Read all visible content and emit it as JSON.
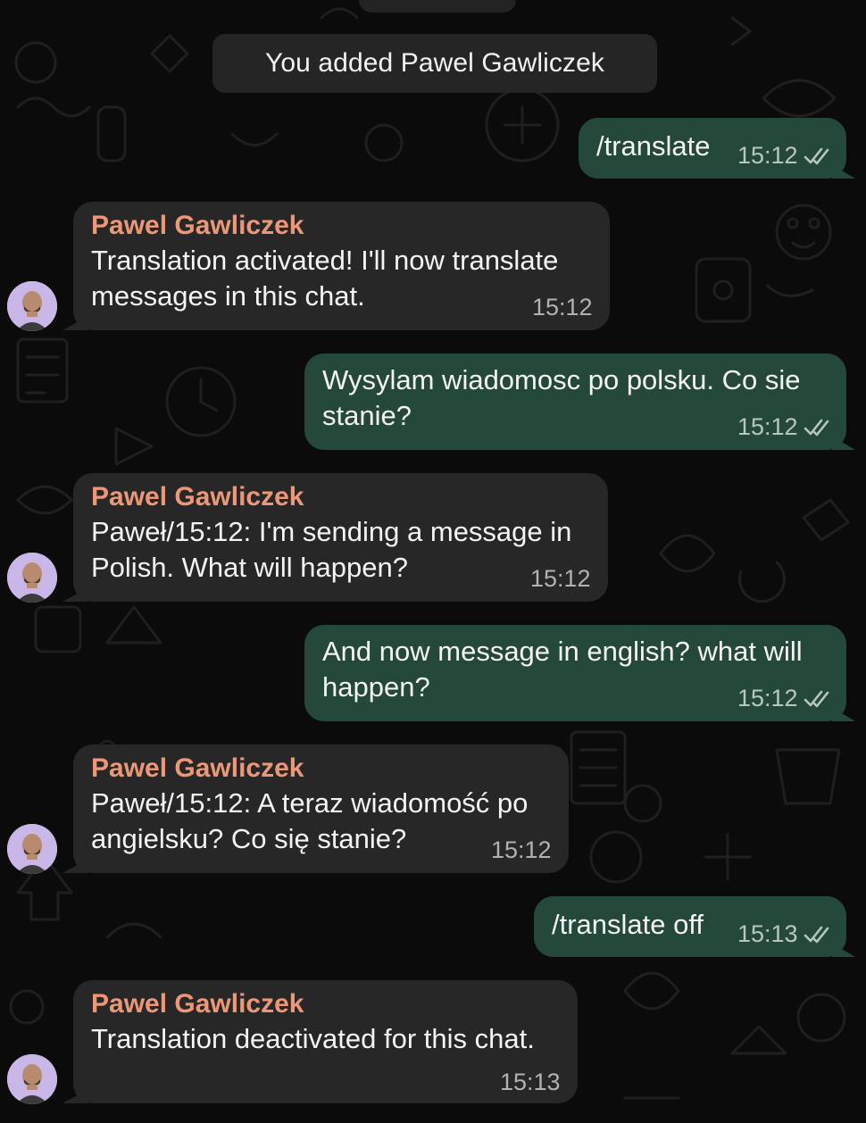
{
  "system_message": "You added Pawel Gawliczek",
  "messages": [
    {
      "direction": "out",
      "lines": [
        "/translate"
      ],
      "time": "15:12",
      "status_icon": "double-check-read-icon"
    },
    {
      "direction": "in",
      "sender": "Pawel Gawliczek",
      "lines": [
        "Translation activated! I'll now translate",
        "messages in this chat."
      ],
      "time": "15:12"
    },
    {
      "direction": "out",
      "lines": [
        "Wysylam wiadomosc po polsku. Co sie",
        "stanie?"
      ],
      "time": "15:12",
      "status_icon": "double-check-read-icon"
    },
    {
      "direction": "in",
      "sender": "Pawel Gawliczek",
      "lines": [
        "Paweł/15:12: I'm sending a message in",
        "Polish. What will happen?"
      ],
      "time": "15:12"
    },
    {
      "direction": "out",
      "lines": [
        "And now message in english? what will",
        "happen?"
      ],
      "time": "15:12",
      "status_icon": "double-check-read-icon"
    },
    {
      "direction": "in",
      "sender": "Pawel Gawliczek",
      "lines": [
        "Paweł/15:12: A teraz wiadomość po",
        "angielsku? Co się stanie?"
      ],
      "time": "15:12"
    },
    {
      "direction": "out",
      "lines": [
        "/translate off"
      ],
      "time": "15:13",
      "status_icon": "double-check-read-icon"
    },
    {
      "direction": "in",
      "sender": "Pawel Gawliczek",
      "lines": [
        "Translation deactivated for this chat."
      ],
      "time": "15:13"
    }
  ],
  "colors": {
    "background": "#0b0b0b",
    "outgoing_bubble": "#24493a",
    "incoming_bubble": "#272727",
    "sender_name": "#ec9878",
    "avatar_bg": "#c9b7e8"
  }
}
